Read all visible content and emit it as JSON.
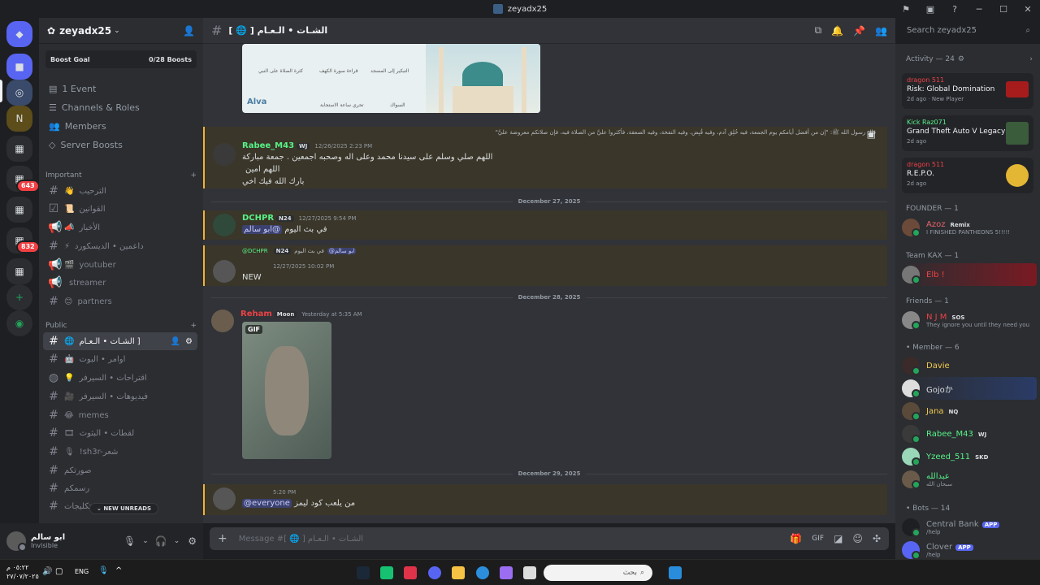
{
  "window": {
    "title": "zeyadx25",
    "controls": [
      "─",
      "☐",
      "✕"
    ],
    "top_icons": [
      "inbox-icon",
      "screen-icon",
      "help-icon"
    ]
  },
  "rail": {
    "badges": [
      "643",
      "832"
    ]
  },
  "server": {
    "name": "zeyadx25",
    "boost_goal": {
      "label": "Boost Goal",
      "value": "0/28 Boosts"
    },
    "nav": [
      "1 Event",
      "Channels & Roles",
      "Members",
      "Server Boosts"
    ]
  },
  "categories": {
    "important": "Important",
    "public": "Public"
  },
  "important_channels": [
    {
      "emoji": "👋",
      "name": "الترحيب"
    },
    {
      "emoji": "📜",
      "name": "القوانين"
    },
    {
      "emoji": "📣",
      "name": "الأخبار"
    },
    {
      "emoji": "⚡",
      "name": "داعمين • الديسكورد"
    },
    {
      "emoji": "🎬",
      "name": "youtuber"
    },
    {
      "emoji": "",
      "name": "streamer"
    },
    {
      "emoji": "😊",
      "name": "partners"
    }
  ],
  "public_channels": [
    {
      "name": "الشـات • الـعـام ]",
      "emoji": "🌐",
      "selected": true
    },
    {
      "name": "اوامر • البوت",
      "emoji": "🤖"
    },
    {
      "name": "اقتراحات • السيرفر",
      "emoji": "💡"
    },
    {
      "name": "فيديوهات • السيرفر",
      "emoji": "🎥"
    },
    {
      "name": "memes",
      "emoji": "😂"
    },
    {
      "name": "لقطات • البثوث",
      "emoji": "🎞"
    },
    {
      "name": "!sh3r-شعر",
      "emoji": "🎙"
    },
    {
      "name": "صورتكم",
      "emoji": ""
    },
    {
      "name": "رسمكم",
      "emoji": ""
    },
    {
      "name": "تكليجات",
      "emoji": ""
    }
  ],
  "new_unreads": "NEW UNREADS",
  "user": {
    "name": "ابو سالم",
    "status": "Invisible"
  },
  "channel": {
    "title": "[ 🌐 ] الشـات • الـعـام",
    "search_placeholder": "Search zeyadx25"
  },
  "image_card": {
    "brand": "Alva",
    "items": [
      "كثرة الصلاة على النبي",
      "قراءة سورة الكهف",
      "التبكير إلى المسجد",
      "تحري ساعة الاستجابة",
      "السواك"
    ]
  },
  "messages": [
    {
      "user": "Rabee_M43",
      "tag": "WJ",
      "time": "12/26/2025 2:23 PM",
      "reply": "قال رسول الله ﷺ: \"إن من أفضل أيامكم يوم الجمعة، فيه خُلِق آدم، وفيه قُبِض، وفيه النفخة، وفيه الصعقة، فأكثروا عليَّ من الصلاة فيه، فإن صلاتكم معروضة عليَّ\"",
      "lines": [
        "اللهم صلي وسلم على سيدنا محمد وعلى اله وصحبه اجمعين . جمعة مباركة",
        "اللهم امين",
        "بارك الله فيك اخي"
      ]
    },
    {
      "user": "DCHPR",
      "tag": "N24",
      "time": "12/27/2025 9:54 PM",
      "text": "في بث اليوم",
      "mention": "@ابو سالم"
    },
    {
      "reply_user": "@DCHPR",
      "reply_tag": "N24",
      "reply_text": "في بث اليوم",
      "reply_mention": "@ابو سالم",
      "time": "12/27/2025 10:02 PM",
      "text": "NEW"
    },
    {
      "user": "Reham",
      "tag": "Moon",
      "time": "Yesterday at 5:35 AM",
      "gif": "GIF"
    },
    {
      "time": "5:20 PM",
      "mention": "@everyone",
      "text": "من يلعب كود ليمز"
    }
  ],
  "dividers": [
    "December 27, 2025",
    "December 28, 2025",
    "December 29, 2025"
  ],
  "composer_placeholder": "Message #[ 🌐 ] الشـات • الـعـام",
  "members": {
    "activity_header": "Activity — 24",
    "activities": [
      {
        "user": "dragon 511",
        "game": "Risk: Global Domination",
        "time": "2d ago",
        "extra": "New Player"
      },
      {
        "user": "Kick Raz071",
        "game": "Grand Theft Auto V Legacy",
        "time": "2d ago"
      },
      {
        "user": "dragon 511",
        "game": "R.E.P.O.",
        "time": "2d ago"
      }
    ],
    "groups": [
      {
        "title": "FOUNDER — 1",
        "items": [
          {
            "name": "Azoz",
            "tag": "Remix",
            "sub": "I FINISHED PANTHEONS 5!!!!!",
            "color": "#e8646a"
          }
        ]
      },
      {
        "title": "Team KAX — 1",
        "items": [
          {
            "name": "Elb !",
            "color": "#ed4245"
          }
        ]
      },
      {
        "title": "Friends — 1",
        "items": [
          {
            "name": "N J M",
            "tag": "SOS",
            "sub": "They ignore you until they need you",
            "color": "#ed4245"
          }
        ]
      },
      {
        "title": "• Member — 6",
        "items": [
          {
            "name": "Davie",
            "color": "#f2c94c"
          },
          {
            "name": "Gojoか",
            "color": "#dbdee1"
          },
          {
            "name": "Jana",
            "tag": "NQ",
            "color": "#f2c94c"
          },
          {
            "name": "Rabee_M43",
            "tag": "WJ",
            "color": "#57f287"
          },
          {
            "name": "Yzeed_511",
            "tag": "SKD",
            "color": "#57f287"
          },
          {
            "name": "عبدالله",
            "sub": "سبحان الله",
            "color": "#57f287"
          }
        ]
      },
      {
        "title": "• Bots — 14",
        "items": [
          {
            "name": "Central Bank",
            "app": "APP",
            "sub": "/help",
            "color": "#949ba4"
          },
          {
            "name": "Clover",
            "app": "APP",
            "sub": "/help",
            "color": "#949ba4"
          }
        ]
      }
    ]
  },
  "taskbar": {
    "clock": "٠٥:٢٢ م",
    "date": "٢٧/٠٧/٢٠٢٥",
    "lang": "ENG",
    "search": "بحث"
  }
}
